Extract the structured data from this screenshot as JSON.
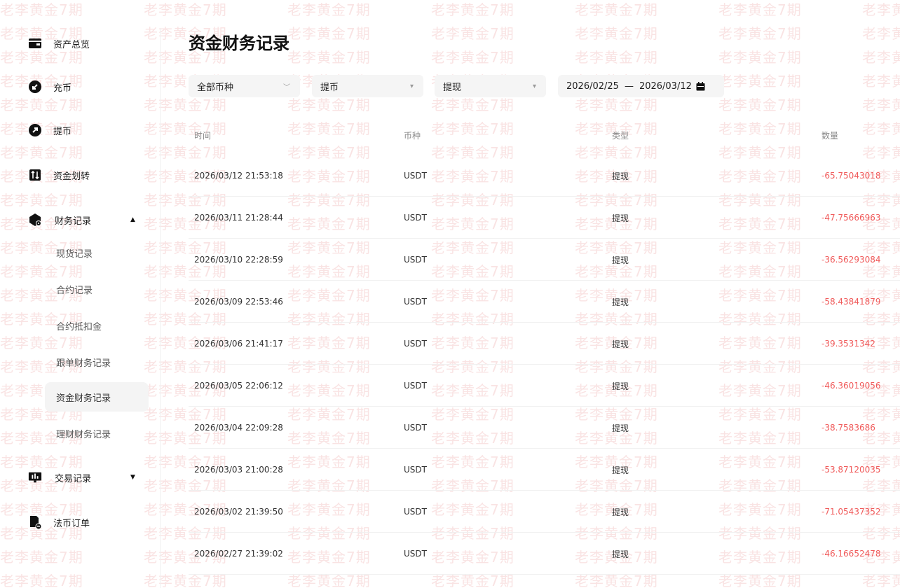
{
  "watermark": {
    "text": "老李黄金7期"
  },
  "sidebar": {
    "items": [
      {
        "label": "资产总览",
        "icon": "wallet-icon"
      },
      {
        "label": "充币",
        "icon": "deposit-icon"
      },
      {
        "label": "提币",
        "icon": "withdraw-icon"
      },
      {
        "label": "资金划转",
        "icon": "transfer-icon"
      },
      {
        "label": "财务记录",
        "icon": "finance-record-icon",
        "expanded": true
      },
      {
        "label": "交易记录",
        "icon": "trade-record-icon",
        "expanded": false
      },
      {
        "label": "法币订单",
        "icon": "fiat-order-icon"
      }
    ],
    "finance_sub": [
      {
        "label": "现货记录"
      },
      {
        "label": "合约记录"
      },
      {
        "label": "合约抵扣金"
      },
      {
        "label": "跟单财务记录"
      },
      {
        "label": "资金财务记录",
        "active": true
      },
      {
        "label": "理财财务记录"
      }
    ]
  },
  "main": {
    "title": "资金财务记录",
    "filters": {
      "coin": "全部币种",
      "category": "提币",
      "type": "提现",
      "date_start": "2026/02/25",
      "date_sep": "—",
      "date_end": "2026/03/12"
    },
    "table": {
      "headers": {
        "time": "时间",
        "coin": "币种",
        "type": "类型",
        "amount": "数量"
      },
      "rows": [
        {
          "time": "2026/03/12 21:53:18",
          "coin": "USDT",
          "type": "提现",
          "amount": "-65.75043018"
        },
        {
          "time": "2026/03/11 21:28:44",
          "coin": "USDT",
          "type": "提现",
          "amount": "-47.75666963"
        },
        {
          "time": "2026/03/10 22:28:59",
          "coin": "USDT",
          "type": "提现",
          "amount": "-36.56293084"
        },
        {
          "time": "2026/03/09 22:53:46",
          "coin": "USDT",
          "type": "提现",
          "amount": "-58.43841879"
        },
        {
          "time": "2026/03/06 21:41:17",
          "coin": "USDT",
          "type": "提现",
          "amount": "-39.3531342"
        },
        {
          "time": "2026/03/05 22:06:12",
          "coin": "USDT",
          "type": "提现",
          "amount": "-46.36019056"
        },
        {
          "time": "2026/03/04 22:09:28",
          "coin": "USDT",
          "type": "提现",
          "amount": "-38.7583686"
        },
        {
          "time": "2026/03/03 21:00:28",
          "coin": "USDT",
          "type": "提现",
          "amount": "-53.87120035"
        },
        {
          "time": "2026/03/02 21:39:50",
          "coin": "USDT",
          "type": "提现",
          "amount": "-71.05437352"
        },
        {
          "time": "2026/02/27 21:39:02",
          "coin": "USDT",
          "type": "提现",
          "amount": "-46.16652478"
        }
      ]
    }
  },
  "colors": {
    "negative_amount": "#f05a5a",
    "watermark": "#f1b7b7",
    "active_bg": "#f4f4f4"
  }
}
